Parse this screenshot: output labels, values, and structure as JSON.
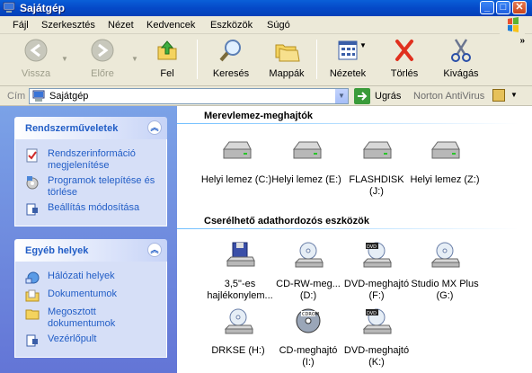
{
  "window": {
    "title": "Sajátgép"
  },
  "menu": [
    "Fájl",
    "Szerkesztés",
    "Nézet",
    "Kedvencek",
    "Eszközök",
    "Súgó"
  ],
  "toolbar": {
    "back": "Vissza",
    "forward": "Előre",
    "up": "Fel",
    "search": "Keresés",
    "folders": "Mappák",
    "views": "Nézetek",
    "delete": "Törlés",
    "cut": "Kivágás"
  },
  "address": {
    "label": "Cím",
    "value": "Sajátgép",
    "go": "Ugrás",
    "norton": "Norton AntiVirus"
  },
  "taskpane": {
    "system_tasks": {
      "title": "Rendszerműveletek",
      "items": [
        "Rendszerinformáció megjelenítése",
        "Programok telepítése és törlése",
        "Beállítás módosítása"
      ]
    },
    "other_places": {
      "title": "Egyéb helyek",
      "items": [
        "Hálózati helyek",
        "Dokumentumok",
        "Megosztott dokumentumok",
        "Vezérlőpult"
      ]
    }
  },
  "groups": {
    "hard_drives": {
      "title": "Merevlemez-meghajtók",
      "items": [
        "Helyi lemez (C:)",
        "Helyi lemez (E:)",
        "FLASHDISK (J:)",
        "Helyi lemez (Z:)"
      ]
    },
    "removable": {
      "title": "Cserélhető adathordozós eszközök",
      "items": [
        "3,5\"-es hajlékonylem...",
        "CD-RW-meg... (D:)",
        "DVD-meghajtó (F:)",
        "Studio MX Plus (G:)",
        "DRKSE (H:)",
        "CD-meghajtó (I:)",
        "DVD-meghajtó (K:)"
      ]
    }
  }
}
